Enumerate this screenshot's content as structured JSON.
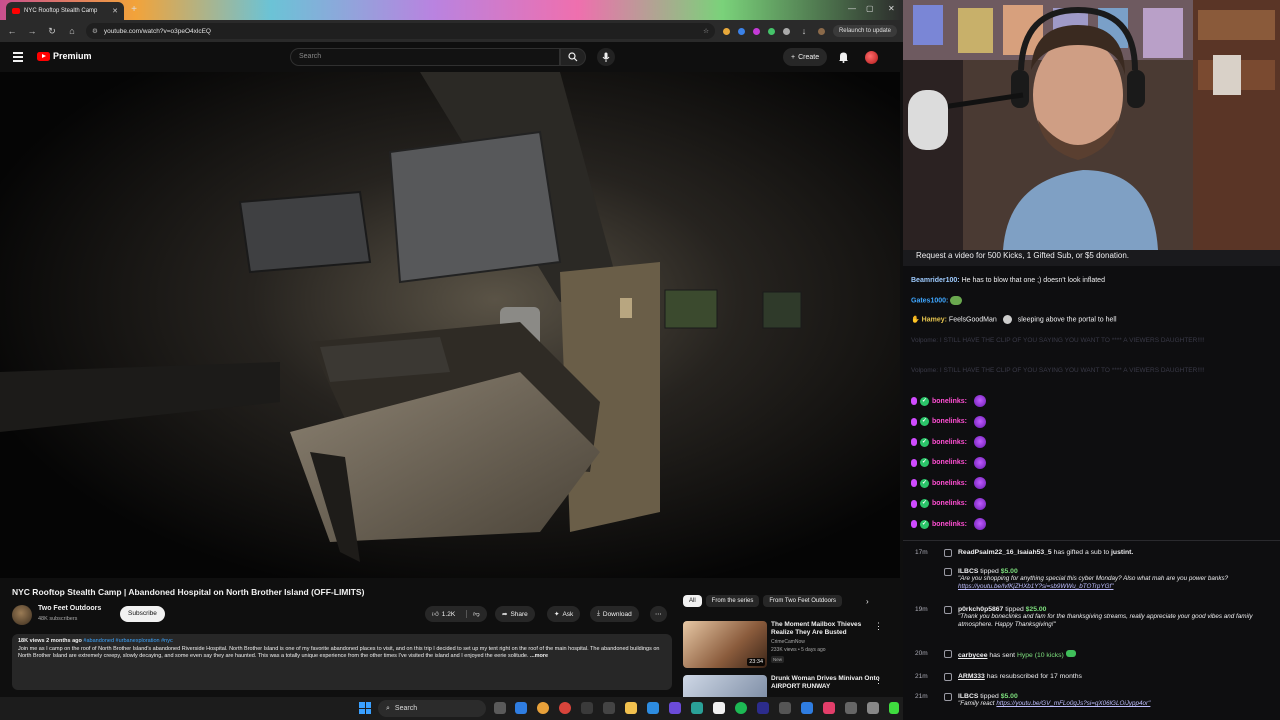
{
  "browser": {
    "tab_title": "NYC Rooftop Stealth Camp",
    "url": "youtube.com/watch?v=o3peO4xlcEQ",
    "relaunch_label": "Relaunch to update"
  },
  "youtube": {
    "logo_text": "Premium",
    "search_placeholder": "Search",
    "create_label": "Create"
  },
  "video": {
    "title": "NYC Rooftop Stealth Camp | Abandoned Hospital on North Brother Island (OFF-LIMITS)",
    "channel": "Two Feet Outdoors",
    "subscribers": "48K subscribers",
    "subscribe_label": "Subscribe",
    "likes": "1.2K",
    "share_label": "Share",
    "ask_label": "Ask",
    "download_label": "Download",
    "stats": "18K views  2 months ago",
    "hashtags": "#abandoned #urbanexploration #nyc",
    "description": "Join me as I camp on the roof of North Brother Island's abandoned Riverside Hospital. North Brother Island is one of my favorite abandoned places to visit, and on this trip I decided to set up my tent right on the roof of the main hospital. The abandoned buildings on North Brother Island are extremely creepy, slowly decaying, and some even say they are haunted. This was a totally unique experience from the other times I've visited the island and I enjoyed the eerie solitude.",
    "more_label": "...more"
  },
  "sidebar": {
    "chips": [
      "All",
      "From the series",
      "From Two Feet Outdoors"
    ],
    "recommendations": [
      {
        "title": "The Moment Mailbox Thieves Realize They Are Busted",
        "channel": "CrimeCamNow",
        "meta": "233K views • 5 days ago",
        "badge": "New",
        "duration": "23:34"
      },
      {
        "title": "Drunk Woman Drives Minivan Onto AIRPORT RUNWAY",
        "channel": "",
        "meta": "",
        "badge": "",
        "duration": ""
      }
    ]
  },
  "stream": {
    "banner": "Request a video for 500 Kicks, 1 Gifted Sub, or $5 donation.",
    "chat": [
      {
        "user": "Beamrider100:",
        "text": "He has to blow that one ;) doesn't look inflated",
        "color": "#9ecbff"
      },
      {
        "user": "Gates1000:",
        "text": "",
        "color": "#3ea6ff"
      },
      {
        "user": "Hamey:",
        "text": "FeelsGoodMan",
        "text2": "sleeping above the portal to hell",
        "color": "#e6c54f"
      }
    ],
    "ghost_lines": [
      "Volpome: I STILL HAVE THE CLIP OF YOU SAYING YOU WANT TO **** A VIEWERS DAUGHTER!!!!",
      "Volpome: I STILL HAVE THE CLIP OF YOU SAYING YOU WANT TO **** A VIEWERS DAUGHTER!!!!"
    ],
    "repeated_user": "bonelinks:",
    "repeat_count": 7
  },
  "events": [
    {
      "time": "17m",
      "user": "ReadPsalm22_16_Isaiah53_5",
      "text": "has gifted a sub to",
      "target": "justint."
    },
    {
      "time": "",
      "user": "ILBCS",
      "text": "tipped",
      "amount": "$5.00",
      "message": "\"Are you shopping for anything special this cyber Monday? Also what mah are you power banks?",
      "link": "https://youtu.be/lvfKjZHXb1Y?si=sb9WWu_bTOTrpYGf\""
    },
    {
      "time": "19m",
      "user": "p0rkch0p5867",
      "text": "tipped",
      "amount": "$25.00",
      "message": "\"Thank you boneclinks and fam for the thanksgiving streams, really appreciate your good vibes and family atmosphere. Happy Thanksgiving!\""
    },
    {
      "time": "20m",
      "user": "carbycee",
      "text": "has sent",
      "hype": "Hype (10 kicks)"
    },
    {
      "time": "21m",
      "user": "ARM333",
      "text": "has resubscribed for 17 months"
    },
    {
      "time": "21m",
      "user": "ILBCS",
      "text": "tipped",
      "amount": "$5.00",
      "message": "\"Family react",
      "link": "https://youtu.be/GV_mFLo0gJs?si=gX06lGLOiJypp4or\""
    }
  ],
  "taskbar": {
    "search_label": "Search"
  },
  "colors": {
    "yt_red": "#ff0000",
    "chat_bg": "#0e0e10",
    "tip_green": "#7ee07e"
  }
}
